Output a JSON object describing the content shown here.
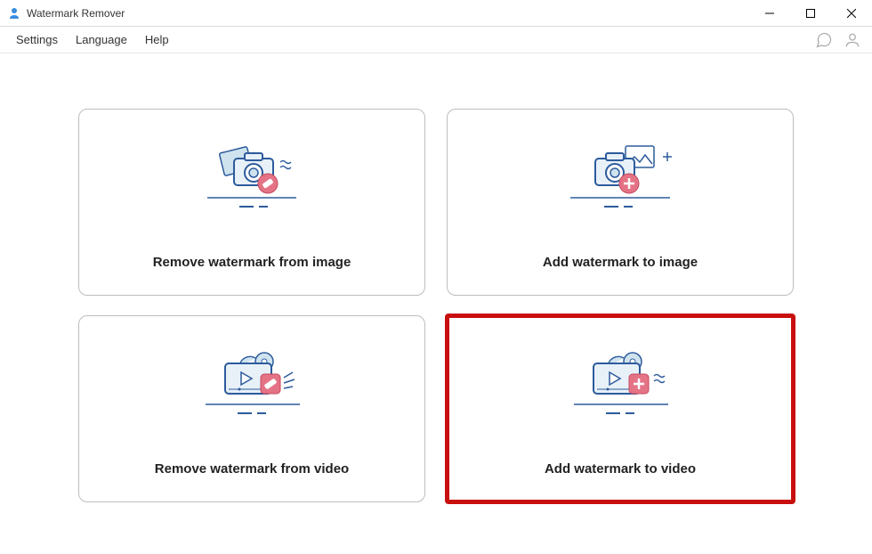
{
  "app": {
    "title": "Watermark Remover"
  },
  "menu": {
    "settings": "Settings",
    "language": "Language",
    "help": "Help"
  },
  "cards": {
    "remove_image": "Remove watermark from image",
    "add_image": "Add watermark to image",
    "remove_video": "Remove watermark from video",
    "add_video": "Add watermark to video"
  },
  "highlighted_card": "add_video"
}
